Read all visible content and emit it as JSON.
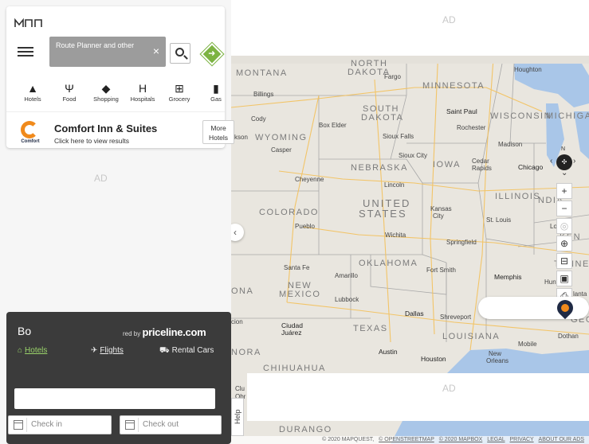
{
  "panel": {
    "route_placeholder": "Route Planner and other",
    "clear_glyph": "×",
    "categories": [
      {
        "label": "Hotels",
        "icon": "hotel-icon",
        "glyph": "▲"
      },
      {
        "label": "Food",
        "icon": "food-icon",
        "glyph": "Ψ"
      },
      {
        "label": "Shopping",
        "icon": "shopping-icon",
        "glyph": "◆"
      },
      {
        "label": "Hospitals",
        "icon": "hospital-icon",
        "glyph": "H"
      },
      {
        "label": "Grocery",
        "icon": "grocery-icon",
        "glyph": "⊞"
      },
      {
        "label": "Gas",
        "icon": "gas-icon",
        "glyph": "▮"
      }
    ],
    "promo_title": "Comfort Inn & Suites",
    "promo_subtitle": "Click here to view results",
    "promo_logo_word": "Comfort",
    "more_label_1": "More",
    "more_label_2": "Hotels",
    "ad_label": "AD"
  },
  "booking": {
    "title": "Bo",
    "powered_prefix": "red by",
    "powered_brand": "priceline.com",
    "tabs": [
      {
        "label": "Hotels",
        "icon": "hotel-icon",
        "active": true
      },
      {
        "label": "Flights",
        "icon": "plane-icon",
        "active": false
      },
      {
        "label": "Rental Cars",
        "icon": "car-icon",
        "active": false
      }
    ],
    "checkin_placeholder": "Check in",
    "checkout_placeholder": "Check out"
  },
  "map": {
    "ad_label": "AD",
    "help_label": "Help",
    "footer_copyright": "© 2020 MAPQUEST,",
    "footer_links": [
      "© OPENSTREETMAP",
      "© 2020 MAPBOX",
      "LEGAL",
      "PRIVACY",
      "ABOUT OUR ADS"
    ],
    "compass_n": "N",
    "states": {
      "north_dakota_1": "NORTH",
      "north_dakota_2": "DAKOTA",
      "montana": "MONTANA",
      "minnesota": "MINNESOTA",
      "south_dakota_1": "SOUTH",
      "south_dakota_2": "DAKOTA",
      "wisconsin": "WISCONSIN",
      "michigan": "MICHIGA",
      "wyoming": "WYOMING",
      "iowa": "IOWA",
      "nebraska": "NEBRASKA",
      "illinois": "ILLINOIS",
      "indiana": "NDIA",
      "colorado": "COLORADO",
      "united_states_1": "UNITED",
      "united_states_2": "STATES",
      "kentucky": "KEN",
      "tennessee": "TENNE",
      "oklahoma": "OKLAHOMA",
      "new_mexico_1": "NEW",
      "new_mexico_2": "MEXICO",
      "texas": "TEXAS",
      "louisiana": "LOUISIANA",
      "chihuahua": "CHIHUAHUA",
      "durango": "DURANGO",
      "nora": "NORA",
      "ona": "ONA",
      "geo": "GEO"
    },
    "cities": {
      "fargo": "Fargo",
      "houghton": "Houghton",
      "billings": "Billings",
      "cody": "Cody",
      "box_elder": "Box Elder",
      "saint_paul": "Saint Paul",
      "rochester": "Rochester",
      "sioux_falls": "Sioux Falls",
      "casper": "Casper",
      "madison": "Madison",
      "sioux_city": "Sioux City",
      "cedar_rapids_1": "Cedar",
      "cedar_rapids_2": "Rapids",
      "chicago": "Chicago",
      "cheyenne": "Cheyenne",
      "lincoln": "Lincoln",
      "kansas_city_1": "Kansas",
      "kansas_city_2": "City",
      "st_louis": "St. Louis",
      "louisville": "Loui",
      "pueblo": "Pueblo",
      "wichita": "Wichita",
      "springfield": "Springfield",
      "santa_fe": "Santa Fe",
      "amarillo": "Amarillo",
      "fort_smith": "Fort Smith",
      "memphis": "Memphis",
      "huntsville": "Huntsvill",
      "atlanta": "lanta",
      "lubbock": "Lubbock",
      "dallas": "Dallas",
      "shreveport": "Shreveport",
      "ciudad_juarez_1": "Ciudad",
      "ciudad_juarez_2": "Juárez",
      "mobile": "Mobile",
      "dothan": "Dothan",
      "austin": "Austin",
      "houston": "Houston",
      "new_orleans_1": "New",
      "new_orleans_2": "Orleans",
      "cksn": "ckson",
      "cion": "cion",
      "clu": "Clu",
      "obr": "Obr"
    }
  },
  "colors": {
    "accent_green": "#7cb342",
    "booking_bg": "#3b3b3b",
    "water": "#a9c6e8"
  }
}
